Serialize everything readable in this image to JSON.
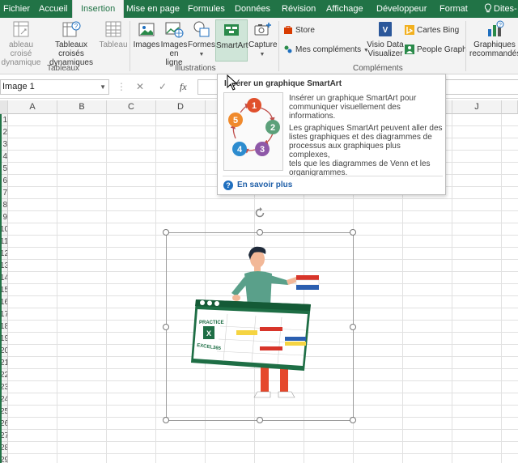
{
  "tabs": [
    {
      "label": "Fichier",
      "active": false
    },
    {
      "label": "Accueil",
      "active": false
    },
    {
      "label": "Insertion",
      "active": true
    },
    {
      "label": "Mise en page",
      "active": false
    },
    {
      "label": "Formules",
      "active": false
    },
    {
      "label": "Données",
      "active": false
    },
    {
      "label": "Révision",
      "active": false
    },
    {
      "label": "Affichage",
      "active": false
    },
    {
      "label": "Développeur",
      "active": false
    },
    {
      "label": "Format",
      "active": false
    }
  ],
  "tell_me": "Dites-",
  "ribbon": {
    "tableaux": {
      "pivot_line1": "ableau croisé",
      "pivot_line2": "dynamique",
      "recommended_line1": "Tableaux croisés",
      "recommended_line2": "dynamiques",
      "table": "Tableau",
      "group_label": "Tableaux"
    },
    "illustrations": {
      "images": "Images",
      "online_line1": "Images",
      "online_line2": "en ligne",
      "shapes": "Formes",
      "smartart": "SmartArt",
      "capture": "Capture",
      "group_label": "Illustrations"
    },
    "complements": {
      "store": "Store",
      "my_addins": "Mes compléments",
      "visio_line1": "Visio Data",
      "visio_line2": "Visualizer",
      "bing_maps": "Cartes Bing",
      "people_graph": "People Graph",
      "group_label": "Compléments"
    },
    "charts": {
      "rec_line1": "Graphiques",
      "rec_line2": "recommandés"
    }
  },
  "formula_bar": {
    "name_box": "Image 1",
    "cancel": "✕",
    "enter": "✓",
    "fx": "fx",
    "formula": ""
  },
  "columns": [
    "A",
    "B",
    "C",
    "D",
    "E",
    "F",
    "G",
    "H",
    "I",
    "J"
  ],
  "rows": [
    "1",
    "2",
    "3",
    "4",
    "5",
    "6",
    "7",
    "8",
    "9",
    "10",
    "11",
    "12",
    "13",
    "14",
    "15",
    "16",
    "17",
    "18",
    "19",
    "20",
    "21",
    "22",
    "23",
    "24",
    "25",
    "26",
    "27",
    "28",
    "29"
  ],
  "tooltip": {
    "title": "Insérer un graphique SmartArt",
    "para1_line1": "Insérer un graphique SmartArt pour",
    "para1_line2": "communiquer visuellement des informations.",
    "para2_line1": "Les graphiques SmartArt peuvent aller des",
    "para2_line2": "listes graphiques et des diagrammes de",
    "para2_line3": "processus aux graphiques plus complexes,",
    "para2_line4": "tels que les diagrammes de Venn et les",
    "para2_line5": "organigrammes.",
    "link": "En savoir plus",
    "cycle_labels": [
      "1",
      "2",
      "3",
      "4",
      "5"
    ]
  },
  "picture": {
    "board_line1": "PRACTICE",
    "board_line2": "EXCEL365"
  },
  "colors": {
    "excel_green": "#217346",
    "ribbon_bg": "#f3f3f3"
  }
}
